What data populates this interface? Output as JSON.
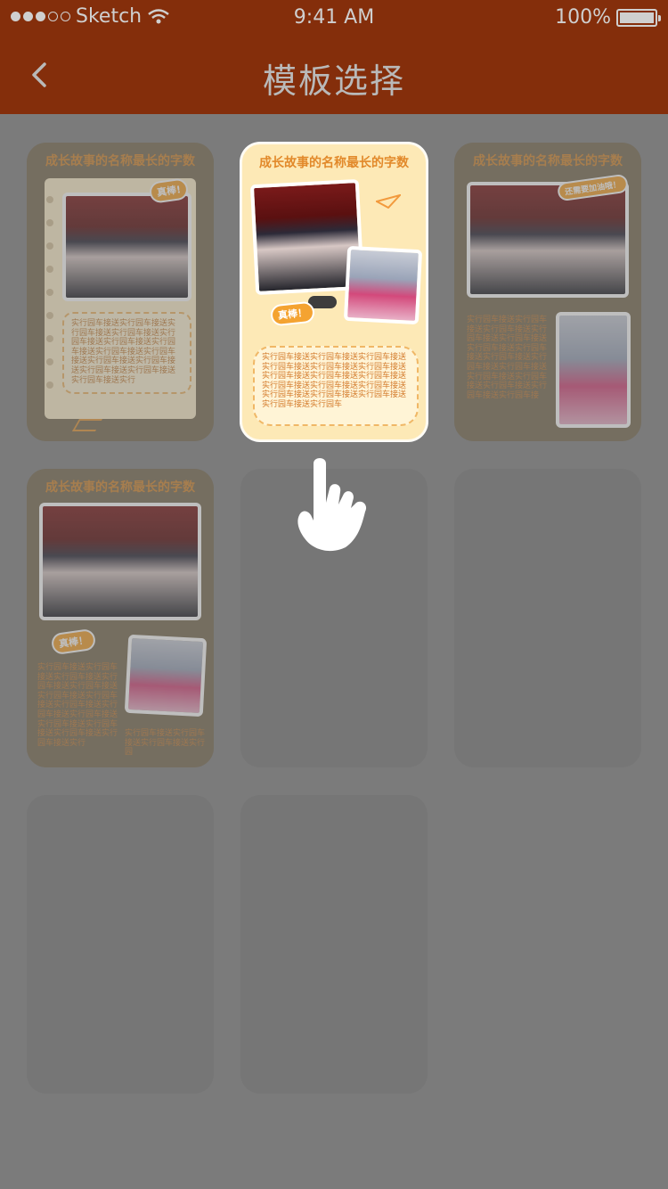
{
  "status_bar": {
    "carrier": "Sketch",
    "time": "9:41 AM",
    "battery": "100%",
    "signal_icon": "signal-dots-icon",
    "wifi_icon": "wifi-icon",
    "battery_icon": "battery-icon"
  },
  "nav": {
    "title": "模板选择",
    "back_icon": "chevron-left-icon"
  },
  "templates": [
    {
      "title": "成长故事的名称最长的字数",
      "text": "实行园车接送实行园车接送实行园车接送实行园车接送实行园车接送实行园车接送实行园车接送实行园车接送实行园车接送实行园车接送实行园车接送实行园车接送实行园车接送实行园车接送实行"
    },
    {
      "title": "成长故事的名称最长的字数",
      "sticker": "真棒！",
      "text": "实行园车接送实行园车接送实行园车接送实行园车接送实行园车接送实行园车接送实行园车接送实行园车接送实行园车接送实行园车接送实行园车接送实行园车接送实行园车接送实行园车接送实行园车接送实行园车接送实行园车"
    },
    {
      "title": "成长故事的名称最长的字数",
      "sticker": "还需要加油哦！",
      "text": "实行园车接送实行园车接送实行园车接送实行园车接送实行园车接送实行园车接送实行园车接送实行园车接送实行园车接送实行园车接送实行园车接送实行园车接送实行园车接送实行园车接送实行园车接"
    },
    {
      "title": "成长故事的名称最长的字数",
      "sticker": "真棒！",
      "text": "实行园车接送实行园车接送实行园车接送实行园车接送实行园车接送实行园车接送实行园车接送实行园车接送实行园车接送实行园车接送实行园车接送实行园车接送实行园车接送实行园车接送实行",
      "text2": "实行园车接送实行园车接送实行园车接送实行园"
    }
  ],
  "colors": {
    "header": "#842e0b",
    "overlay": "#7b7b7b",
    "accent": "#f4a331",
    "card_selected": "#fde9b6"
  },
  "pointer_icon": "tap-hand-icon"
}
